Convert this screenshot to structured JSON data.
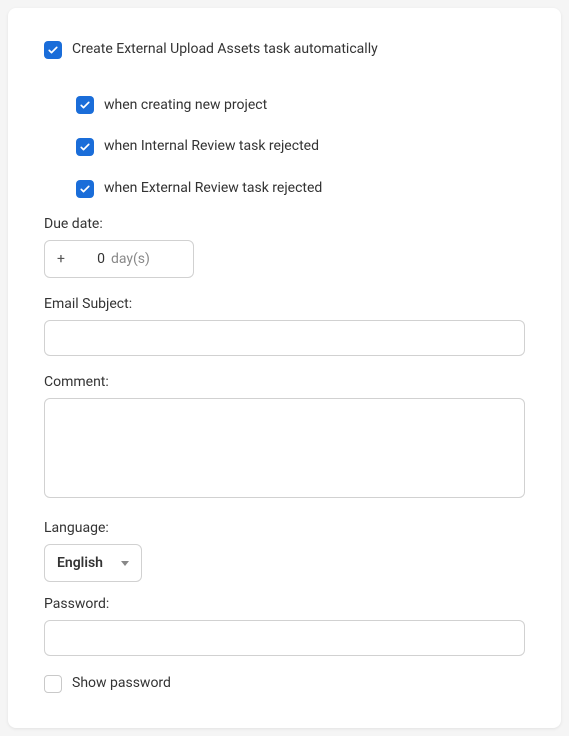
{
  "auto_task": {
    "label": "Create External Upload Assets task automatically",
    "sub": [
      "when creating new project",
      "when Internal Review task rejected",
      "when External Review task rejected"
    ]
  },
  "due_date": {
    "label": "Due date:",
    "sign": "+",
    "value": "0",
    "unit": "day(s)"
  },
  "email_subject": {
    "label": "Email Subject:",
    "value": ""
  },
  "comment": {
    "label": "Comment:",
    "value": ""
  },
  "language": {
    "label": "Language:",
    "selected": "English"
  },
  "password": {
    "label": "Password:",
    "value": ""
  },
  "show_password": {
    "label": "Show password"
  }
}
